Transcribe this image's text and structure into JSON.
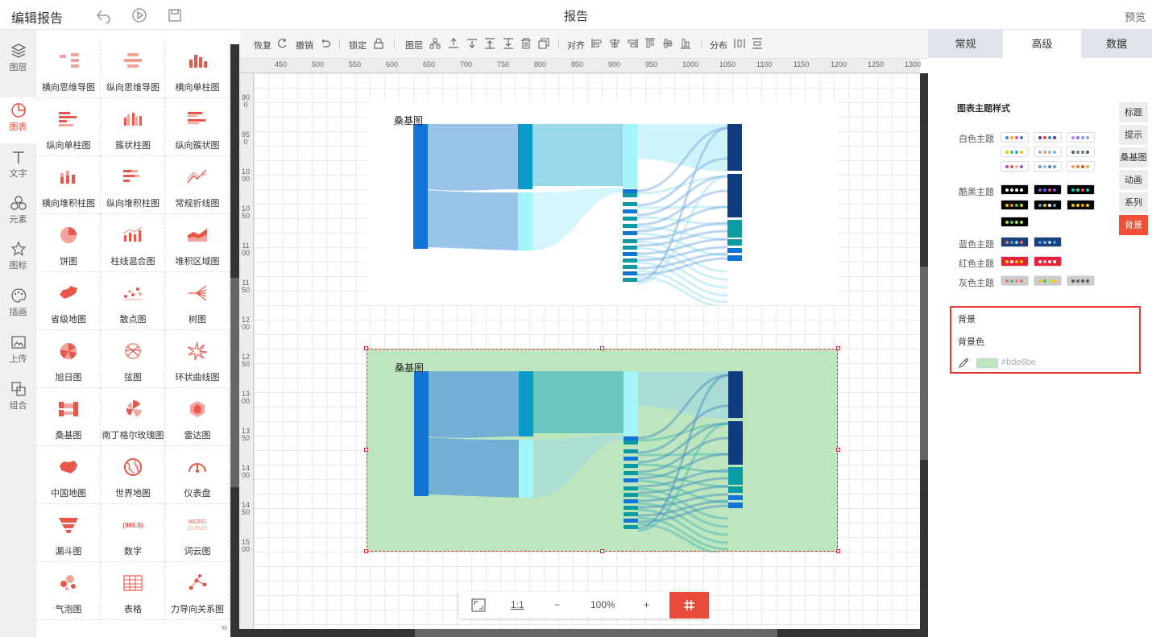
{
  "header": {
    "title": "编辑报告",
    "center_title": "报告",
    "preview": "预览"
  },
  "leftnav": [
    {
      "label": "图层",
      "icon": "layers-icon"
    },
    {
      "label": "图表",
      "icon": "chart-pie-icon",
      "active": true
    },
    {
      "label": "文字",
      "icon": "text-icon"
    },
    {
      "label": "元素",
      "icon": "elements-icon"
    },
    {
      "label": "图标",
      "icon": "star-icon"
    },
    {
      "label": "插画",
      "icon": "palette-icon"
    },
    {
      "label": "上传",
      "icon": "upload-image-icon"
    },
    {
      "label": "组合",
      "icon": "group-icon"
    }
  ],
  "palette": [
    {
      "label": "横向思维导图",
      "icon": "h-mindmap-icon"
    },
    {
      "label": "纵向思维导图",
      "icon": "v-mindmap-icon"
    },
    {
      "label": "横向单柱图",
      "icon": "h-bar-icon"
    },
    {
      "label": "纵向单柱图",
      "icon": "v-bar-icon"
    },
    {
      "label": "簇状柱图",
      "icon": "cluster-bar-icon"
    },
    {
      "label": "纵向簇状图",
      "icon": "v-cluster-icon"
    },
    {
      "label": "横向堆积柱图",
      "icon": "h-stack-icon"
    },
    {
      "label": "纵向堆积柱图",
      "icon": "v-stack-icon"
    },
    {
      "label": "常规折线图",
      "icon": "line-chart-icon"
    },
    {
      "label": "饼图",
      "icon": "pie-chart-icon"
    },
    {
      "label": "柱线混合图",
      "icon": "bar-line-icon"
    },
    {
      "label": "堆积区域图",
      "icon": "area-chart-icon"
    },
    {
      "label": "省级地图",
      "icon": "province-map-icon"
    },
    {
      "label": "散点图",
      "icon": "scatter-icon"
    },
    {
      "label": "树图",
      "icon": "tree-icon"
    },
    {
      "label": "旭日图",
      "icon": "sunburst-icon"
    },
    {
      "label": "弦图",
      "icon": "chord-icon"
    },
    {
      "label": "环状曲线图",
      "icon": "ring-curve-icon"
    },
    {
      "label": "桑基图",
      "icon": "sankey-icon"
    },
    {
      "label": "南丁格尔玫瑰图",
      "icon": "rose-icon"
    },
    {
      "label": "雷达图",
      "icon": "radar-icon"
    },
    {
      "label": "中国地图",
      "icon": "china-map-icon"
    },
    {
      "label": "世界地图",
      "icon": "world-map-icon"
    },
    {
      "label": "仪表盘",
      "icon": "gauge-icon"
    },
    {
      "label": "漏斗图",
      "icon": "funnel-icon"
    },
    {
      "label": "数字",
      "icon": "number-icon",
      "glyph": "(965.0)"
    },
    {
      "label": "词云图",
      "icon": "wordcloud-icon",
      "glyph": "WORD CLOUD"
    },
    {
      "label": "气泡图",
      "icon": "bubble-icon"
    },
    {
      "label": "表格",
      "icon": "table-icon"
    },
    {
      "label": "力导向关系图",
      "icon": "force-graph-icon"
    }
  ],
  "toolbar": {
    "redo": "恢复",
    "undo": "撤销",
    "lock": "锁定",
    "layer": "图层",
    "align": "对齐",
    "distribute": "分布"
  },
  "ruler_h": [
    "450",
    "500",
    "550",
    "600",
    "650",
    "700",
    "750",
    "800",
    "850",
    "900",
    "950",
    "1000",
    "1050",
    "1100",
    "1150",
    "1200",
    "1250",
    "1300"
  ],
  "ruler_v": [
    "900",
    "950",
    "1000",
    "1050",
    "1100",
    "1150",
    "1200",
    "1250",
    "1300",
    "1350",
    "1400",
    "1450",
    "1500"
  ],
  "charts": [
    {
      "title": "桑基图",
      "background": "#ffffff"
    },
    {
      "title": "桑基图",
      "background": "#bde6be"
    }
  ],
  "zoom": {
    "fit_label": "fit-screen-icon",
    "one_to_one": "1:1",
    "minus": "−",
    "value": "100%",
    "plus": "+"
  },
  "rightpanel": {
    "tabs": [
      "常规",
      "高级",
      "数据"
    ],
    "active_tab": "高级",
    "theme_section_title": "图表主题样式",
    "themes": [
      {
        "label": "白色主题"
      },
      {
        "label": "酷黑主题"
      },
      {
        "label": "蓝色主题"
      },
      {
        "label": "红色主题"
      },
      {
        "label": "灰色主题"
      }
    ],
    "side_tabs": [
      "标题",
      "提示",
      "桑基图",
      "动画",
      "系列",
      "背景"
    ],
    "active_side_tab": "背景",
    "bg_section_title": "背景",
    "bg_color_label": "背景色",
    "bg_color_value": "#bde6be"
  }
}
